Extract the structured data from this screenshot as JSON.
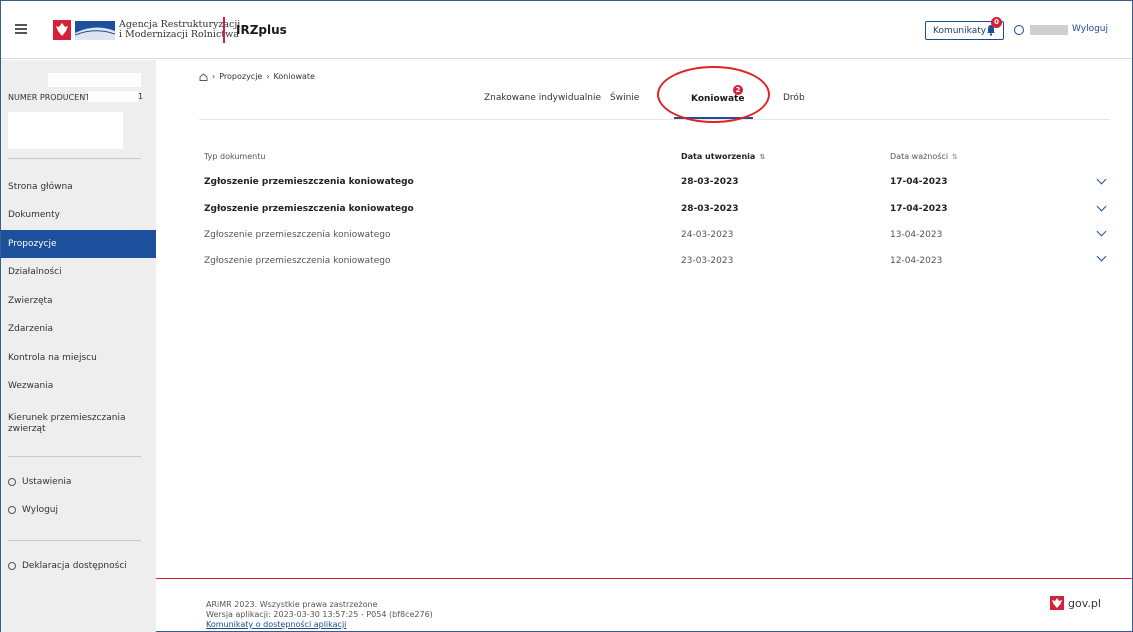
{
  "header": {
    "agency_line1": "Agencja Restrukturyzacji",
    "agency_line2": "i Modernizacji Rolnictwa",
    "app_title": "IRZplus",
    "komunikaty_label": "Komunikaty",
    "komunikaty_badge": "0",
    "logout_label": "Wyloguj"
  },
  "sidebar": {
    "producer_label": "NUMER PRODUCENTA:",
    "producer_suffix": "1",
    "nav": [
      {
        "label": "Strona główna",
        "active": false
      },
      {
        "label": "Dokumenty",
        "active": false
      },
      {
        "label": "Propozycje",
        "active": true
      },
      {
        "label": "Działalności",
        "active": false
      },
      {
        "label": "Zwierzęta",
        "active": false
      },
      {
        "label": "Zdarzenia",
        "active": false
      },
      {
        "label": "Kontrola na miejscu",
        "active": false
      },
      {
        "label": "Wezwania",
        "active": false
      },
      {
        "label": "Kierunek przemieszczania zwierząt",
        "active": false
      }
    ],
    "settings_label": "Ustawienia",
    "logout_label": "Wyloguj",
    "accessibility_label": "Deklaracja dostępności"
  },
  "breadcrumb": {
    "level1": "Propozycje",
    "level2": "Koniowate"
  },
  "tabs": [
    {
      "label": "Znakowane indywidualnie",
      "active": false
    },
    {
      "label": "Świnie",
      "active": false
    },
    {
      "label": "Koniowate",
      "active": true,
      "badge": "2"
    },
    {
      "label": "Drób",
      "active": false
    }
  ],
  "table": {
    "columns": [
      "Typ dokumentu",
      "Data utworzenia",
      "Data ważności"
    ],
    "rows": [
      {
        "type": "Zgłoszenie przemieszczenia koniowatego",
        "created": "28-03-2023",
        "valid": "17-04-2023",
        "bold": true
      },
      {
        "type": "Zgłoszenie przemieszczenia koniowatego",
        "created": "28-03-2023",
        "valid": "17-04-2023",
        "bold": true
      },
      {
        "type": "Zgłoszenie przemieszczenia koniowatego",
        "created": "24-03-2023",
        "valid": "13-04-2023",
        "bold": false
      },
      {
        "type": "Zgłoszenie przemieszczenia koniowatego",
        "created": "23-03-2023",
        "valid": "12-04-2023",
        "bold": false
      }
    ]
  },
  "footer": {
    "copyright": "ARiMR 2023. Wszystkie prawa zastrzeżone",
    "version": "Wersja aplikacji: 2023-03-30 13:57:25 - P054 (bf8ce276)",
    "link": "Komunikaty o dostępności aplikacji",
    "govpl": "gov.pl"
  },
  "colors": {
    "primary": "#1c4f9c",
    "accent_red": "#d6203a",
    "sidebar_bg": "#eeeeee"
  }
}
